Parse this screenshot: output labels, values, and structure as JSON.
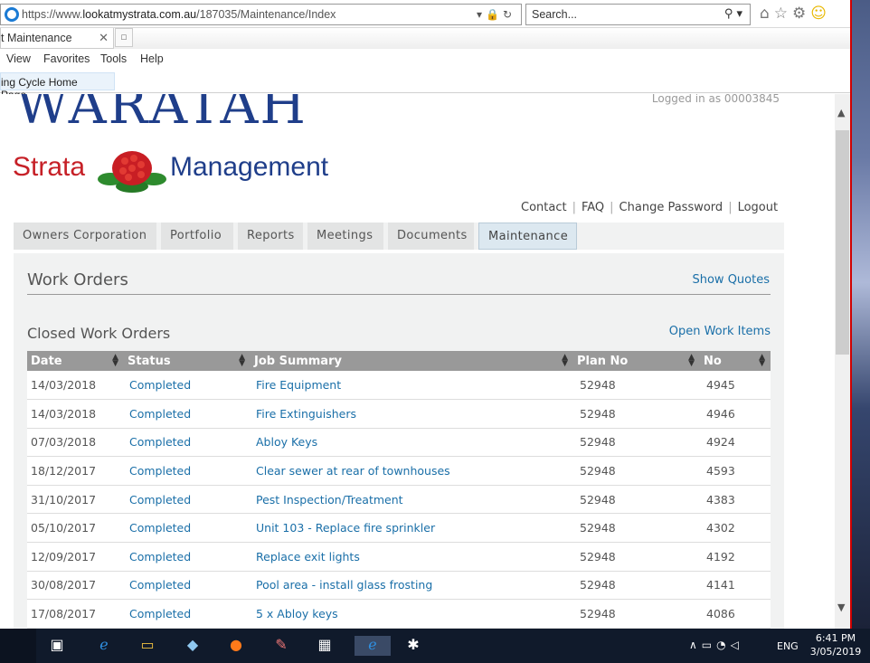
{
  "browser": {
    "url_prefix": "https://www.",
    "url_host": "lookatmystrata.com.au",
    "url_path": "/187035/Maintenance/Index",
    "search_placeholder": "Search...",
    "tab_title": "t Maintenance",
    "menu": [
      "View",
      "Favorites",
      "Tools",
      "Help"
    ],
    "favorite": "ing Cycle Home Page..."
  },
  "header": {
    "logo_line1": "WARATAH",
    "logo_left": "Strata",
    "logo_right": "Management",
    "logged_in": "Logged in as 00003845",
    "links": [
      "Contact",
      "FAQ",
      "Change Password",
      "Logout"
    ]
  },
  "nav": [
    "Owners Corporation",
    "Portfolio",
    "Reports",
    "Meetings",
    "Documents",
    "Maintenance"
  ],
  "main": {
    "title": "Work Orders",
    "show_quotes": "Show Quotes",
    "section": "Closed Work Orders",
    "open_items": "Open Work Items",
    "columns": [
      "Date",
      "Status",
      "Job Summary",
      "Plan No",
      "No"
    ],
    "rows": [
      [
        "14/03/2018",
        "Completed",
        "Fire Equipment",
        "52948",
        "4945"
      ],
      [
        "14/03/2018",
        "Completed",
        "Fire Extinguishers",
        "52948",
        "4946"
      ],
      [
        "07/03/2018",
        "Completed",
        "Abloy Keys",
        "52948",
        "4924"
      ],
      [
        "18/12/2017",
        "Completed",
        "Clear sewer at rear of townhouses",
        "52948",
        "4593"
      ],
      [
        "31/10/2017",
        "Completed",
        "Pest Inspection/Treatment",
        "52948",
        "4383"
      ],
      [
        "05/10/2017",
        "Completed",
        "Unit 103 - Replace fire sprinkler",
        "52948",
        "4302"
      ],
      [
        "12/09/2017",
        "Completed",
        "Replace exit lights",
        "52948",
        "4192"
      ],
      [
        "30/08/2017",
        "Completed",
        "Pool area - install glass frosting",
        "52948",
        "4141"
      ],
      [
        "17/08/2017",
        "Completed",
        "5 x Abloy keys",
        "52948",
        "4086"
      ]
    ]
  },
  "taskbar": {
    "lang": "ENG",
    "time": "6:41 PM",
    "date": "3/05/2019"
  }
}
